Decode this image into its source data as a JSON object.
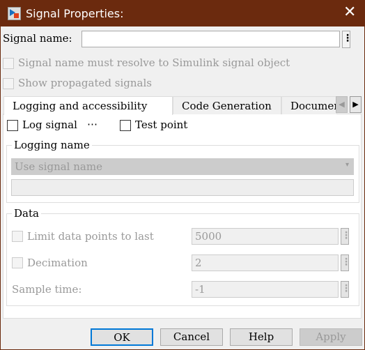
{
  "window": {
    "title": "Signal Properties:"
  },
  "signal_name": {
    "label": "Signal name:",
    "value": ""
  },
  "options": {
    "resolve_label": "Signal name must resolve to Simulink signal object",
    "propagated_label": "Show propagated signals"
  },
  "tabs": [
    {
      "label": "Logging and accessibility",
      "active": true
    },
    {
      "label": "Code Generation"
    },
    {
      "label": "Documentation"
    }
  ],
  "logging": {
    "log_signal_label": "Log signal",
    "log_signal_more": "⋯",
    "test_point_label": "Test point",
    "group_label": "Logging name",
    "dropdown_value": "Use signal name",
    "name_value": ""
  },
  "data_group": {
    "label": "Data",
    "limit_label": "Limit data points to last",
    "limit_value": "5000",
    "decimation_label": "Decimation",
    "decimation_value": "2",
    "sample_time_label": "Sample time:",
    "sample_time_value": "-1"
  },
  "buttons": {
    "ok": "OK",
    "cancel": "Cancel",
    "help": "Help",
    "apply": "Apply"
  },
  "colors": {
    "titlebar": "#6b2a0e",
    "ok_focus": "#0078d7"
  }
}
